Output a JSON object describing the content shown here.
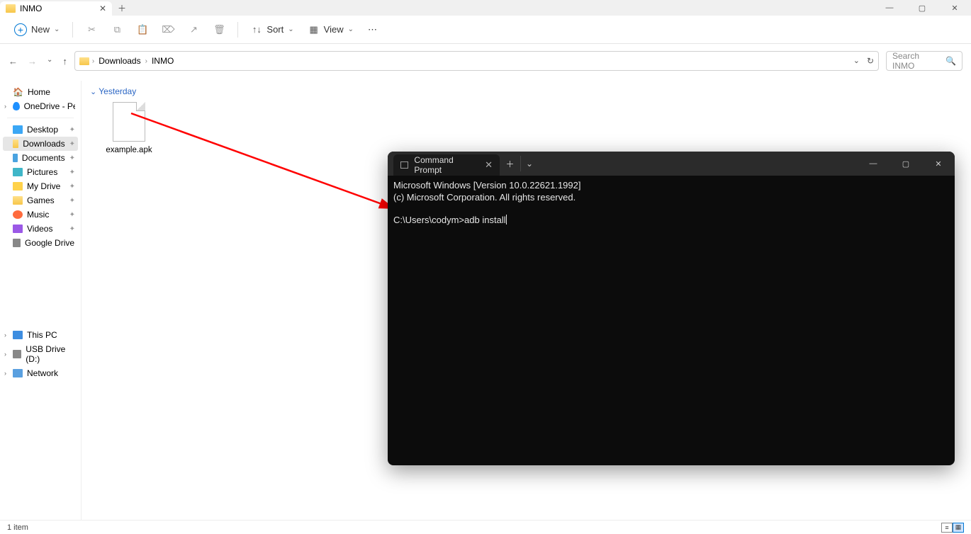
{
  "tab": {
    "title": "INMO"
  },
  "toolbar": {
    "new_label": "New",
    "sort_label": "Sort",
    "view_label": "View"
  },
  "breadcrumb": {
    "items": [
      "Downloads",
      "INMO"
    ]
  },
  "search": {
    "placeholder": "Search INMO"
  },
  "sidebar": {
    "home": "Home",
    "onedrive": "OneDrive - Persona",
    "quick": [
      {
        "label": "Desktop",
        "icon": "desktop"
      },
      {
        "label": "Downloads",
        "icon": "folder",
        "selected": true
      },
      {
        "label": "Documents",
        "icon": "doc"
      },
      {
        "label": "Pictures",
        "icon": "pic"
      },
      {
        "label": "My Drive",
        "icon": "drive"
      },
      {
        "label": "Games",
        "icon": "folder"
      },
      {
        "label": "Music",
        "icon": "music"
      },
      {
        "label": "Videos",
        "icon": "video"
      },
      {
        "label": "Google Drive (G:",
        "icon": "gdrive"
      }
    ],
    "bottom": [
      {
        "label": "This PC",
        "icon": "pc"
      },
      {
        "label": "USB Drive (D:)",
        "icon": "usb"
      },
      {
        "label": "Network",
        "icon": "net"
      }
    ]
  },
  "main": {
    "group": "Yesterday",
    "file": "example.apk"
  },
  "status": {
    "text": "1 item"
  },
  "cmd": {
    "tab_title": "Command Prompt",
    "line1": "Microsoft Windows [Version 10.0.22621.1992]",
    "line2": "(c) Microsoft Corporation. All rights reserved.",
    "prompt": "C:\\Users\\codym>adb install"
  }
}
